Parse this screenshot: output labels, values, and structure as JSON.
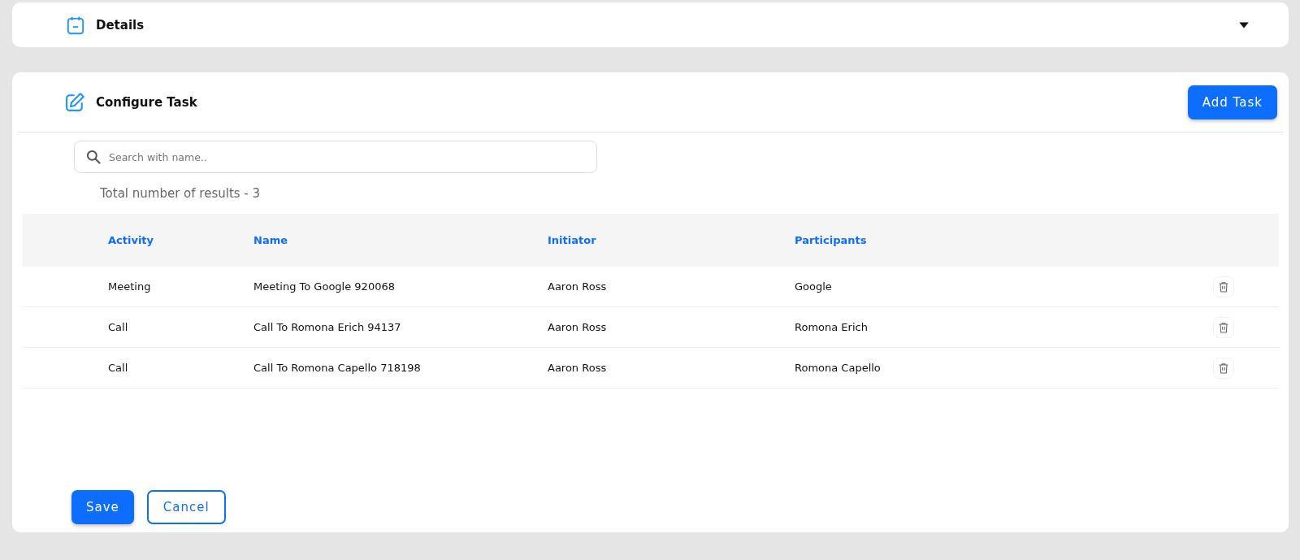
{
  "details_section": {
    "title": "Details",
    "expanded": false
  },
  "configure_section": {
    "title": "Configure Task",
    "add_button": "Add Task",
    "search": {
      "placeholder": "Search with name.."
    },
    "results_count": "Total number of results - 3",
    "table": {
      "columns": [
        "Activity",
        "Name",
        "Initiator",
        "Participants"
      ],
      "rows": [
        {
          "cells": [
            "Meeting",
            "Meeting To Google 920068",
            "Aaron Ross",
            "Google"
          ]
        },
        {
          "cells": [
            "Call",
            "Call To Romona Erich 94137",
            "Aaron Ross",
            "Romona Erich"
          ]
        },
        {
          "cells": [
            "Call",
            "Call To Romona Capello 718198",
            "Aaron Ross",
            "Romona Capello"
          ]
        }
      ]
    },
    "buttons": [
      {
        "label": "Save",
        "kind": "primary"
      },
      {
        "label": "Cancel",
        "kind": "secondary"
      }
    ]
  }
}
